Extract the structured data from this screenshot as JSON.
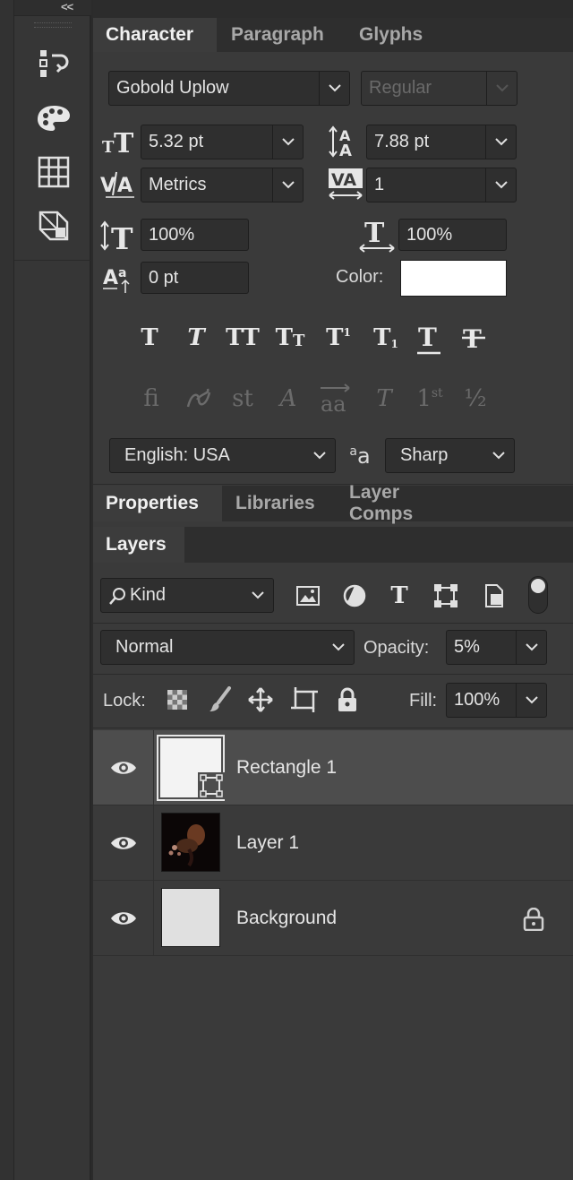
{
  "toolbar": {
    "collapse_label": "<<",
    "icons": [
      "history-icon",
      "palette-icon",
      "grid-icon",
      "transform-icon"
    ]
  },
  "character_panel": {
    "tabs": [
      {
        "label": "Character",
        "active": true
      },
      {
        "label": "Paragraph",
        "active": false
      },
      {
        "label": "Glyphs",
        "active": false
      }
    ],
    "font_family": "Gobold Uplow",
    "font_style": "Regular",
    "font_size": "5.32 pt",
    "leading": "7.88 pt",
    "kerning": "Metrics",
    "tracking": "1",
    "vertical_scale": "100%",
    "horizontal_scale": "100%",
    "baseline_shift": "0 pt",
    "color_label": "Color:",
    "color_value": "#ffffff",
    "type_styles": [
      "faux-bold",
      "faux-italic",
      "all-caps",
      "small-caps",
      "superscript",
      "subscript",
      "underline",
      "strikethrough"
    ],
    "opentype_glyphs": [
      "fi",
      "ornament",
      "st",
      "A",
      "aa",
      "T",
      "1st",
      "½"
    ],
    "language": "English: USA",
    "antialias_icon": "aa",
    "antialias": "Sharp"
  },
  "properties_panel": {
    "tabs": [
      {
        "label": "Properties",
        "active": true
      },
      {
        "label": "Libraries",
        "active": false
      },
      {
        "label": "Layer Comps",
        "active": false
      }
    ]
  },
  "layers_panel": {
    "tab_label": "Layers",
    "filter_kind": "Kind",
    "blend_mode": "Normal",
    "opacity_label": "Opacity:",
    "opacity": "5%",
    "lock_label": "Lock:",
    "fill_label": "Fill:",
    "fill": "100%",
    "layers": [
      {
        "name": "Rectangle 1",
        "selected": true,
        "type": "shape",
        "locked": false
      },
      {
        "name": "Layer 1",
        "selected": false,
        "type": "image",
        "locked": false
      },
      {
        "name": "Background",
        "selected": false,
        "type": "fill",
        "locked": true
      }
    ]
  }
}
